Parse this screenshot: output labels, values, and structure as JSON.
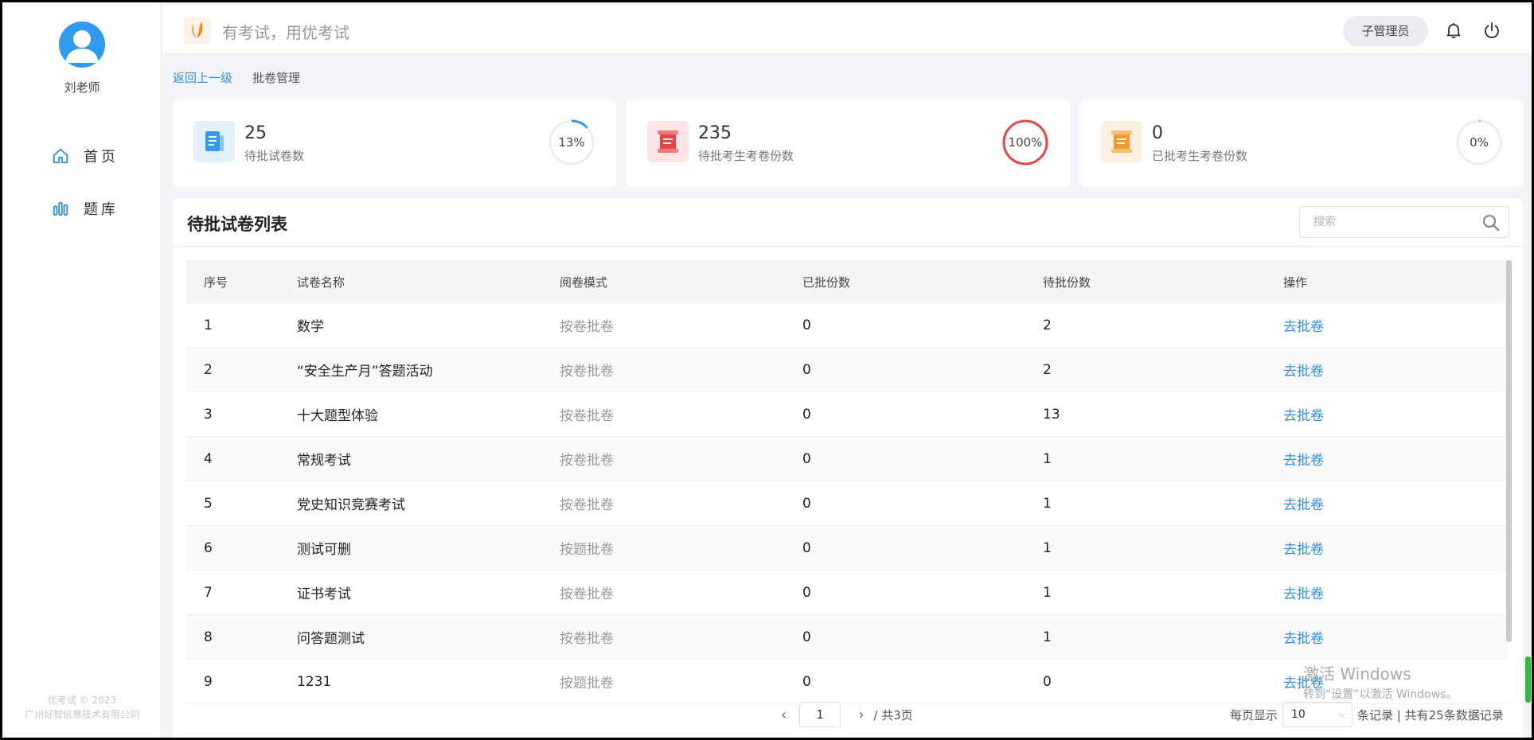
{
  "sidebar": {
    "user_name": "刘老师",
    "nav": [
      {
        "label": "首页",
        "icon": "home-icon"
      },
      {
        "label": "题库",
        "icon": "bar-chart-icon"
      }
    ],
    "footer_line1": "优考试 © 2023",
    "footer_line2": "广州好智信息技术有限公司"
  },
  "header": {
    "slogan": "有考试，用优考试",
    "role_label": "子管理员"
  },
  "breadcrumb": {
    "back": "返回上一级",
    "current": "批卷管理"
  },
  "stats": [
    {
      "value": "25",
      "label": "待批试卷数",
      "percent_text": "13%",
      "percent": 0.13,
      "accent": "#2f9bef",
      "icon": "document-icon"
    },
    {
      "value": "235",
      "label": "待批考生考卷份数",
      "percent_text": "100%",
      "percent": 1.0,
      "accent": "#e84444",
      "icon": "scroll-icon"
    },
    {
      "value": "0",
      "label": "已批考生考卷份数",
      "percent_text": "0%",
      "percent": 0.0,
      "accent": "#f29a2e",
      "icon": "scroll-check-icon"
    }
  ],
  "table": {
    "title": "待批试卷列表",
    "search_placeholder": "搜索",
    "columns": [
      "序号",
      "试卷名称",
      "阅卷模式",
      "已批份数",
      "待批份数",
      "操作"
    ],
    "rows": [
      {
        "no": "1",
        "name": "数学",
        "mode": "按卷批卷",
        "done": "0",
        "pending": "2",
        "action": "去批卷"
      },
      {
        "no": "2",
        "name": "“安全生产月”答题活动",
        "mode": "按卷批卷",
        "done": "0",
        "pending": "2",
        "action": "去批卷"
      },
      {
        "no": "3",
        "name": "十大题型体验",
        "mode": "按卷批卷",
        "done": "0",
        "pending": "13",
        "action": "去批卷"
      },
      {
        "no": "4",
        "name": "常规考试",
        "mode": "按卷批卷",
        "done": "0",
        "pending": "1",
        "action": "去批卷"
      },
      {
        "no": "5",
        "name": "党史知识竞赛考试",
        "mode": "按卷批卷",
        "done": "0",
        "pending": "1",
        "action": "去批卷"
      },
      {
        "no": "6",
        "name": "测试可删",
        "mode": "按题批卷",
        "done": "0",
        "pending": "1",
        "action": "去批卷"
      },
      {
        "no": "7",
        "name": "证书考试",
        "mode": "按卷批卷",
        "done": "0",
        "pending": "1",
        "action": "去批卷"
      },
      {
        "no": "8",
        "name": "问答题测试",
        "mode": "按卷批卷",
        "done": "0",
        "pending": "1",
        "action": "去批卷"
      },
      {
        "no": "9",
        "name": "1231",
        "mode": "按题批卷",
        "done": "0",
        "pending": "0",
        "action": "去批卷"
      }
    ]
  },
  "pagination": {
    "current_page": "1",
    "total_pages_text": "/ 共3页",
    "per_page_label": "每页显示",
    "per_page_value": "10",
    "records_text": "条记录 | 共有25条数据记录"
  },
  "watermark": {
    "line1": "激活 Windows",
    "line2": "转到“设置”以激活 Windows。"
  }
}
